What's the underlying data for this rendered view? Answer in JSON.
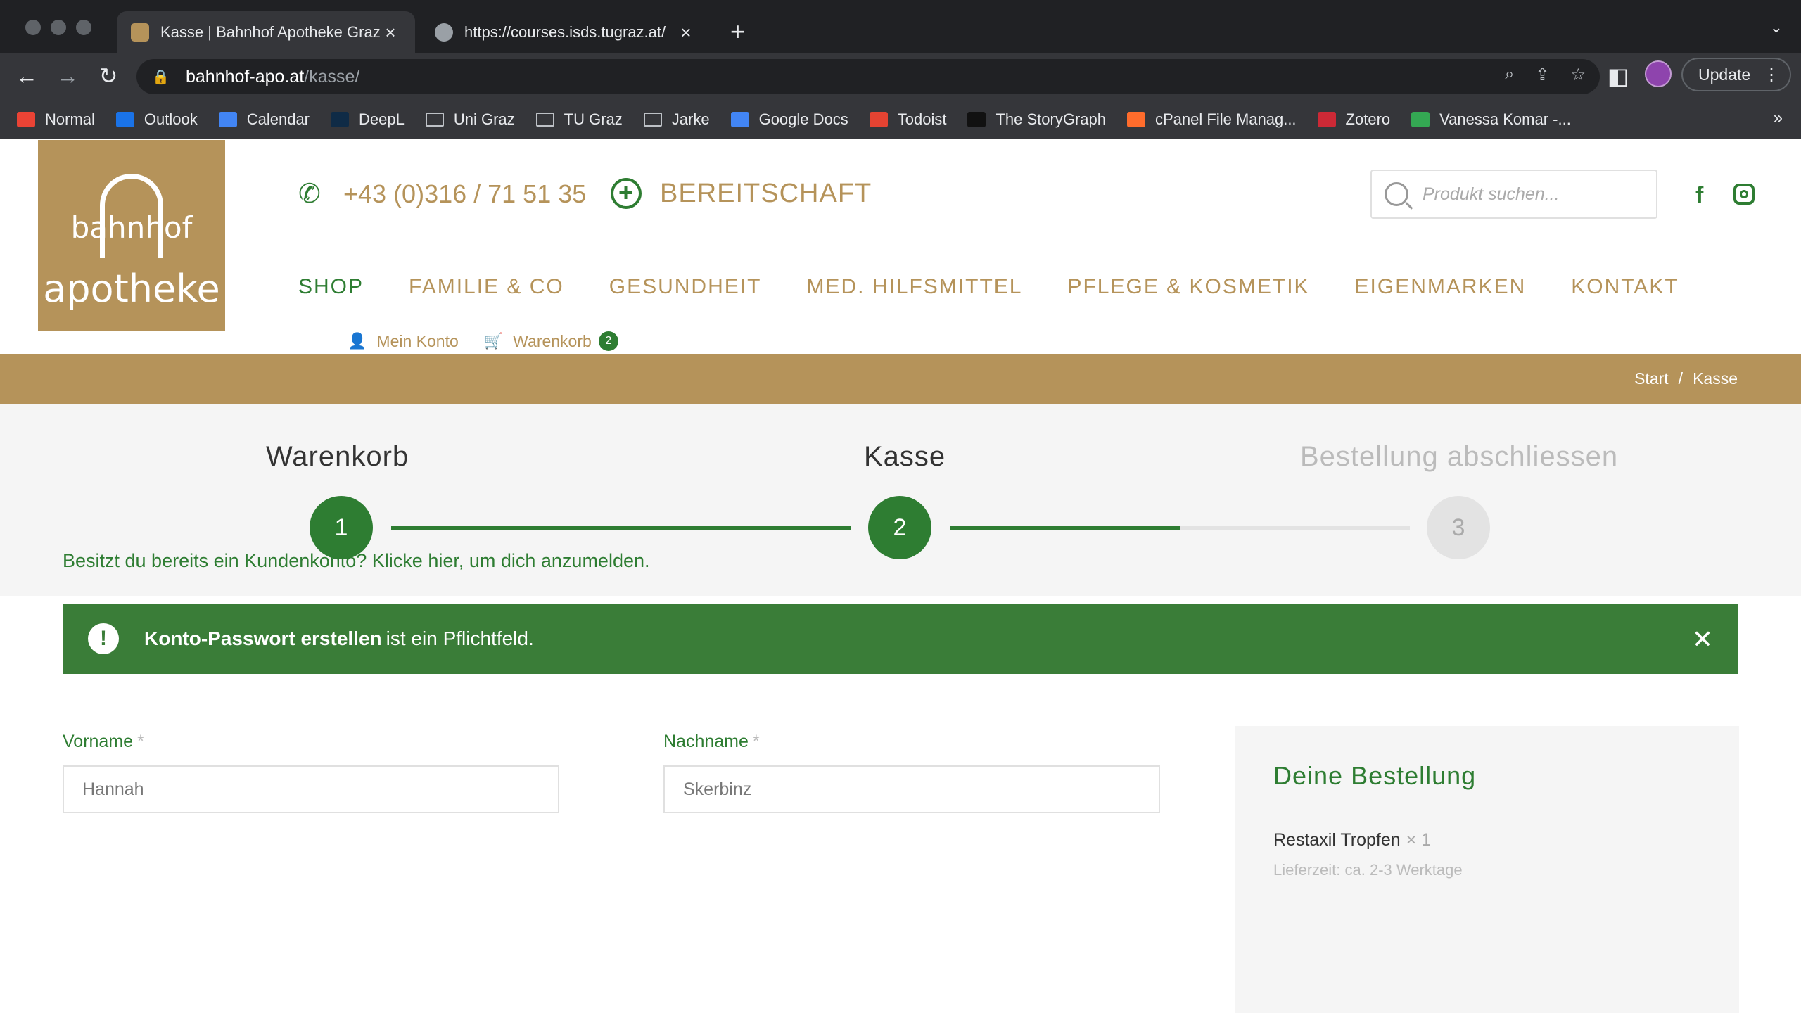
{
  "browser": {
    "tabs": [
      {
        "title": "Kasse | Bahnhof Apotheke Graz",
        "active": true
      },
      {
        "title": "https://courses.isds.tugraz.at/",
        "active": false
      }
    ],
    "url_host": "bahnhof-apo.at",
    "url_path": "/kasse/",
    "update_label": "Update",
    "bookmarks": [
      {
        "label": "Normal",
        "color": "#ea4335"
      },
      {
        "label": "Outlook",
        "color": "#1a73e8"
      },
      {
        "label": "Calendar",
        "color": "#4285f4"
      },
      {
        "label": "DeepL",
        "color": "#0f2b46"
      },
      {
        "label": "Uni Graz",
        "folder": true
      },
      {
        "label": "TU Graz",
        "folder": true
      },
      {
        "label": "Jarke",
        "folder": true
      },
      {
        "label": "Google Docs",
        "color": "#4285f4"
      },
      {
        "label": "Todoist",
        "color": "#e44332"
      },
      {
        "label": "The StoryGraph",
        "color": "#111111"
      },
      {
        "label": "cPanel File Manag...",
        "color": "#ff6c2c"
      },
      {
        "label": "Zotero",
        "color": "#cc2936"
      },
      {
        "label": "Vanessa Komar -...",
        "color": "#34a853"
      }
    ]
  },
  "site": {
    "logo": {
      "line1": "bahnhof",
      "line2": "apotheke"
    },
    "phone": "+43 (0)316 / 71 51 35",
    "bereitschaft": "BEREITSCHAFT",
    "search_placeholder": "Produkt suchen...",
    "nav": [
      "SHOP",
      "FAMILIE & CO",
      "GESUNDHEIT",
      "MED. HILFSMITTEL",
      "PFLEGE & KOSMETIK",
      "EIGENMARKEN",
      "KONTAKT"
    ],
    "account_label": "Mein Konto",
    "cart_label": "Warenkorb",
    "cart_count": "2",
    "breadcrumb": {
      "start": "Start",
      "sep": "/",
      "current": "Kasse"
    },
    "accent_green": "#2e7d32",
    "accent_gold": "#b5935a"
  },
  "steps": [
    {
      "label": "Warenkorb",
      "number": "1",
      "done": true
    },
    {
      "label": "Kasse",
      "number": "2",
      "done": true
    },
    {
      "label": "Bestellung abschliessen",
      "number": "3",
      "done": false
    }
  ],
  "step_progress": {
    "line1": 1.0,
    "line2": 0.5
  },
  "checkout": {
    "login_hint": "Besitzt du bereits ein Kundenkonto? Klicke hier, um dich anzumelden.",
    "notice_bold": "Konto-Passwort erstellen",
    "notice_rest": "ist ein Pflichtfeld.",
    "firstname_label": "Vorname",
    "firstname_value": "Hannah",
    "lastname_label": "Nachname",
    "lastname_value": "Skerbinz",
    "required_mark": "*"
  },
  "order": {
    "title": "Deine Bestellung",
    "product": "Restaxil Tropfen",
    "qty": "× 1",
    "delivery": "Lieferzeit: ca. 2-3 Werktage"
  }
}
